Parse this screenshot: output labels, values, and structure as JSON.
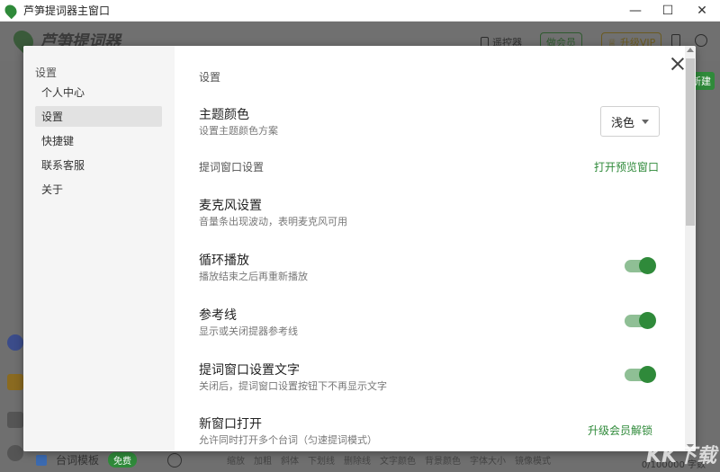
{
  "window": {
    "title": "芦笋提词器主窗口"
  },
  "app": {
    "brand": "芦笋提词器",
    "header_buttons": {
      "remote": "遥控器",
      "member": "做会员",
      "vip": "升级VIP"
    },
    "bottom_item": "台词模板",
    "bottom_badge": "免费",
    "bottom_tools": [
      "缩放",
      "加粗",
      "斜体",
      "下划线",
      "删除线",
      "文字颜色",
      "背景颜色",
      "字体大小",
      "镜像模式"
    ],
    "word_count": "0/100000 字数",
    "green_chip": "新建"
  },
  "modal": {
    "sidebar_title": "设置",
    "nav": [
      {
        "label": "个人中心",
        "active": false
      },
      {
        "label": "设置",
        "active": true
      },
      {
        "label": "快捷键",
        "active": false
      },
      {
        "label": "联系客服",
        "active": false
      },
      {
        "label": "关于",
        "active": false
      }
    ],
    "content": {
      "section_title": "设置",
      "theme": {
        "title": "主题颜色",
        "desc": "设置主题颜色方案",
        "value": "浅色"
      },
      "prompter_section": {
        "label": "提词窗口设置",
        "link": "打开预览窗口"
      },
      "mic": {
        "title": "麦克风设置",
        "desc": "音量条出现波动，表明麦克风可用"
      },
      "loop": {
        "title": "循环播放",
        "desc": "播放结束之后再重新播放",
        "on": true
      },
      "guide": {
        "title": "参考线",
        "desc": "显示或关闭提器参考线",
        "on": true
      },
      "text": {
        "title": "提词窗口设置文字",
        "desc": "关闭后，提词窗口设置按钮下不再显示文字",
        "on": true
      },
      "newwin": {
        "title": "新窗口打开",
        "desc": "允许同时打开多个台词（匀速提词模式）",
        "link": "升级会员解锁"
      }
    }
  },
  "watermark": "KK下载",
  "colors": {
    "accent": "#2f8a3a",
    "toggle_track": "#8fbf95"
  }
}
